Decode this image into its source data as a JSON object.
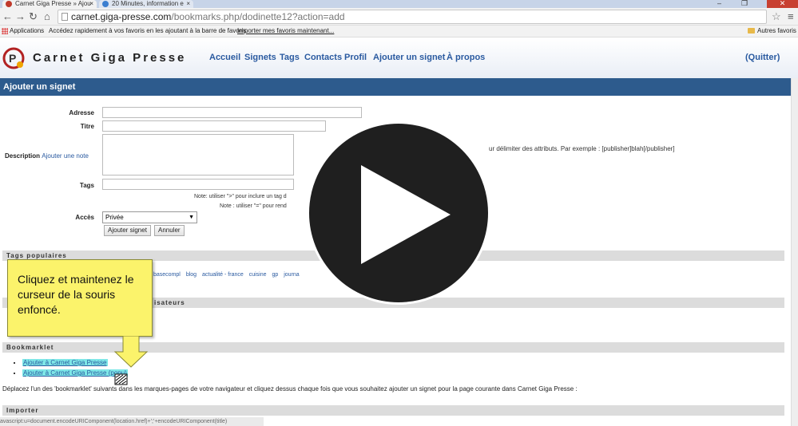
{
  "browser": {
    "tabs": [
      {
        "title": "Carnet Giga Presse » Ajou",
        "close": "×"
      },
      {
        "title": "20 Minutes, information e",
        "close": "×"
      }
    ],
    "url_domain": "carnet.giga-presse.com",
    "url_path": "/bookmarks.php/dodinette12?action=add",
    "bookmarks_bar": {
      "apps": "Applications",
      "hint": "Accédez rapidement à vos favoris en les ajoutant à la barre de favoris.",
      "import": "Importer mes favoris maintenant...",
      "other": "Autres favoris"
    }
  },
  "site": {
    "brand": "Carnet Giga Presse",
    "nav": [
      "Accueil",
      "Signets",
      "Tags",
      "Contacts",
      "Profil",
      "Ajouter un signet",
      "À propos"
    ],
    "quit": "(Quitter)",
    "page_title": "Ajouter un signet"
  },
  "form": {
    "address_label": "Adresse",
    "title_label": "Titre",
    "description_label": "Description",
    "add_note": "Ajouter une note",
    "desc_hint": "ur délimiter des attributs. Par exemple : [publisher]blah[/publisher]",
    "tags_label": "Tags",
    "tags_note1": "Note: utiliser \">\" pour inclure un tag d",
    "tags_note2": "Note : utiliser \"=\" pour rend",
    "access_label": "Accès",
    "access_value": "Privée",
    "submit": "Ajouter signet",
    "cancel": "Annuler"
  },
  "sections": {
    "popular_tags": "Tags populaires",
    "users_tags": "isateurs",
    "bookmarklet": "Bookmarklet",
    "import": "Importer"
  },
  "popular_tags": [
    "basecompl",
    "blog",
    "actualité - france",
    "cuisine",
    "gp",
    "journa"
  ],
  "bookmarklet": {
    "items": [
      "Ajouter à Carnet Giga Presse",
      "Ajouter à Carnet Giga Presse (popu)"
    ],
    "instructions": "Déplacez l'un des 'bookmarklet' suivants dans les marques-pages de votre navigateur et cliquez dessus chaque fois que vous souhaitez ajouter un signet pour la page courante dans Carnet Giga Presse :",
    "snippet": "avascript:u=document.encodeURIComponent(location.href)+';'+encodeURIComponent(title)"
  },
  "callout": {
    "text": "Cliquez et maintenez le curseur de la souris enfoncé."
  },
  "colors": {
    "header_bar": "#2d5b8d",
    "nav_link": "#2a5aa0",
    "callout": "#fbf36b",
    "highlight": "#7fe7e7"
  }
}
